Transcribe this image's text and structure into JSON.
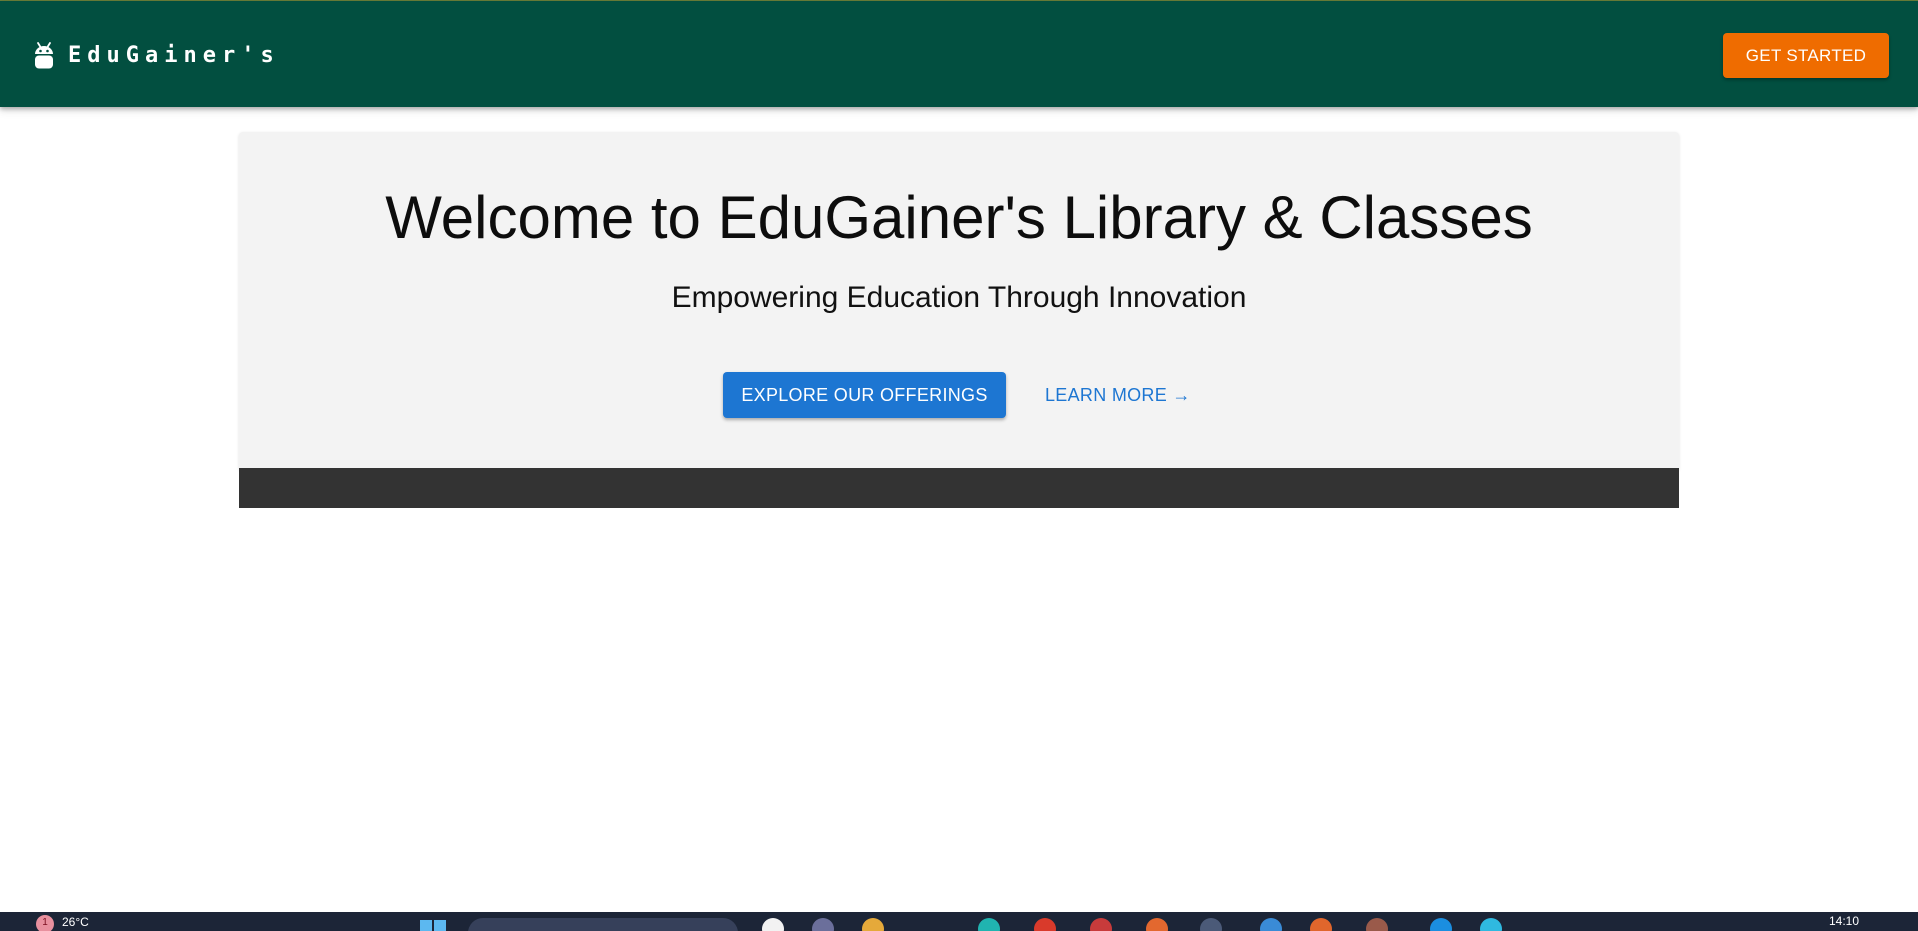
{
  "header": {
    "brand_name": "EduGainer's",
    "brand_icon": "android-icon",
    "cta_label": "GET STARTED",
    "background_color": "#024f40",
    "cta_color": "#ef6c00"
  },
  "hero": {
    "title": "Welcome to EduGainer's Library & Classes",
    "subtitle": "Empowering Education Through Innovation",
    "primary_button_label": "EXPLORE OUR OFFERINGS",
    "secondary_button_label": "LEARN MORE →",
    "primary_color": "#1d76d2",
    "background_color": "#f3f3f3"
  },
  "taskbar": {
    "weather_badge": "1",
    "temperature": "26°C",
    "clock": "14:10"
  }
}
